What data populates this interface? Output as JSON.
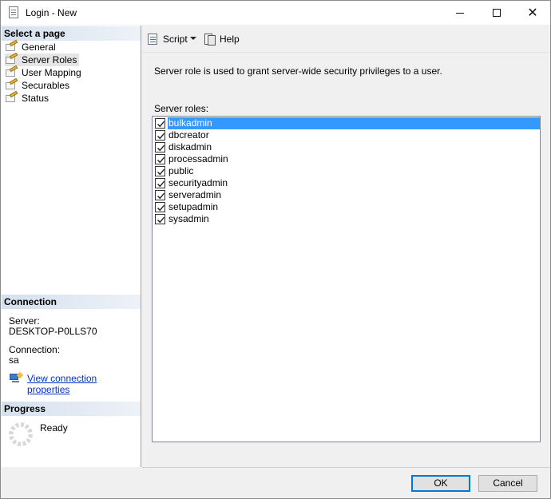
{
  "window": {
    "title": "Login - New",
    "controls": {
      "minimize": "minimize",
      "maximize": "maximize",
      "close": "✕"
    }
  },
  "left_pane": {
    "select_page_header": "Select a page",
    "pages": [
      {
        "label": "General",
        "icon": "page-wrench-icon"
      },
      {
        "label": "Server Roles",
        "icon": "page-wrench-icon",
        "selected": true
      },
      {
        "label": "User Mapping",
        "icon": "page-wrench-icon"
      },
      {
        "label": "Securables",
        "icon": "page-wrench-icon"
      },
      {
        "label": "Status",
        "icon": "page-wrench-icon"
      }
    ],
    "connection_header": "Connection",
    "server_label": "Server:",
    "server_value": "DESKTOP-P0LLS70",
    "connection_label": "Connection:",
    "connection_value": "sa",
    "view_connection_link": "View connection properties",
    "progress_header": "Progress",
    "progress_status": "Ready"
  },
  "toolbar": {
    "script_label": "Script",
    "help_label": "Help"
  },
  "main": {
    "description": "Server role is used to grant server-wide security privileges to a user.",
    "roles_label": "Server roles:",
    "roles": [
      {
        "name": "bulkadmin",
        "checked": true,
        "selected": true
      },
      {
        "name": "dbcreator",
        "checked": true
      },
      {
        "name": "diskadmin",
        "checked": true
      },
      {
        "name": "processadmin",
        "checked": true
      },
      {
        "name": "public",
        "checked": true
      },
      {
        "name": "securityadmin",
        "checked": true
      },
      {
        "name": "serveradmin",
        "checked": true
      },
      {
        "name": "setupadmin",
        "checked": true
      },
      {
        "name": "sysadmin",
        "checked": true
      }
    ]
  },
  "buttons": {
    "ok": "OK",
    "cancel": "Cancel"
  },
  "colors": {
    "selection": "#3399ff",
    "section_header": "#d5e0ee",
    "link": "#0033cc",
    "default_button_border": "#0078d7"
  }
}
